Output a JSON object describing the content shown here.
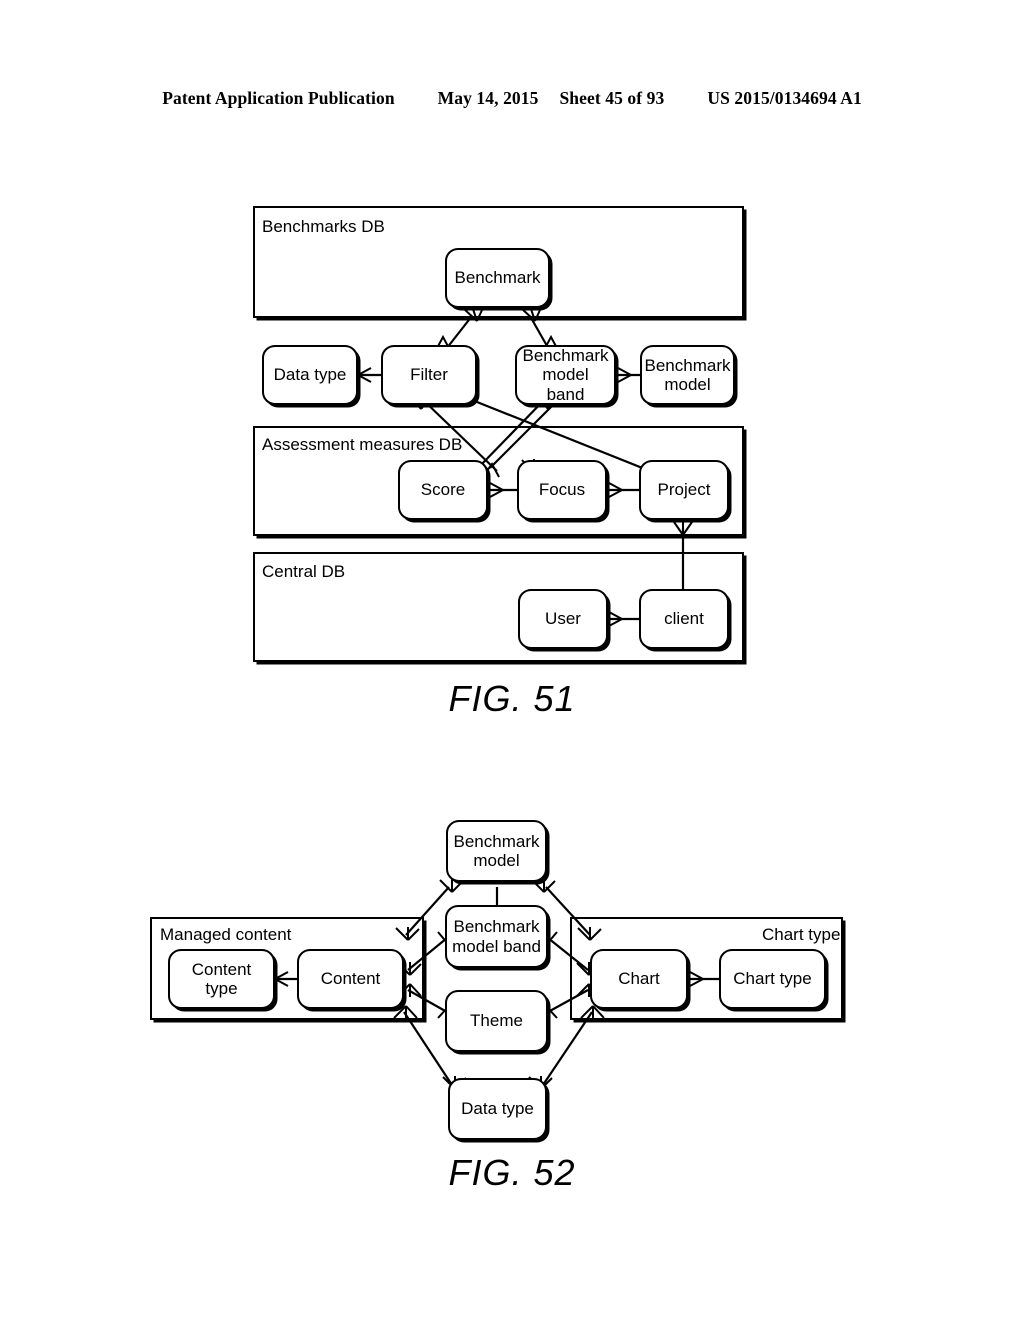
{
  "header": {
    "publication": "Patent Application Publication",
    "date": "May 14, 2015",
    "sheet": "Sheet 45 of 93",
    "patent_number": "US 2015/0134694 A1"
  },
  "figures": [
    {
      "caption": "FIG. 51",
      "containers": [
        {
          "label": "Benchmarks DB"
        },
        {
          "label": "Assessment measures DB"
        },
        {
          "label": "Central DB"
        }
      ],
      "entities": [
        {
          "label": "Benchmark"
        },
        {
          "label": "Data type"
        },
        {
          "label": "Filter"
        },
        {
          "label": "Benchmark model band"
        },
        {
          "label": "Benchmark model"
        },
        {
          "label": "Score"
        },
        {
          "label": "Focus"
        },
        {
          "label": "Project"
        },
        {
          "label": "User"
        },
        {
          "label": "client"
        }
      ]
    },
    {
      "caption": "FIG. 52",
      "containers": [
        {
          "label": "Managed content"
        },
        {
          "label": "Chart type"
        }
      ],
      "entities": [
        {
          "label": "Benchmark model"
        },
        {
          "label": "Content type"
        },
        {
          "label": "Content"
        },
        {
          "label": "Benchmark model band"
        },
        {
          "label": "Theme"
        },
        {
          "label": "Data type"
        },
        {
          "label": "Chart"
        },
        {
          "label": "Chart type"
        }
      ]
    }
  ]
}
